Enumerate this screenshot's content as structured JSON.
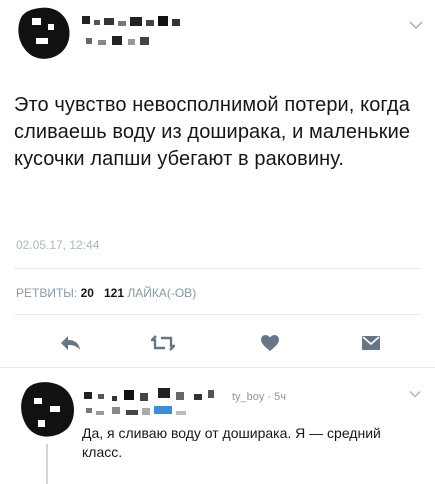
{
  "tweet": {
    "text": "Это чувство невосполнимой потери, когда сливаешь воду из доширака, и маленькие кусочки лапши убегают в раковину.",
    "timestamp": "02.05.17, 12:44",
    "retweets_label": "РЕТВИТЫ:",
    "retweets_count": "20",
    "likes_count": "121",
    "likes_label": "ЛАЙКА(-ОВ)"
  },
  "reply": {
    "handle_meta": "ty_boy · 5ч",
    "text": "Да, я сливаю воду от доширака. Я — средний класс."
  },
  "icons": {
    "reply": "reply-icon",
    "retweet": "retweet-icon",
    "like": "heart-icon",
    "message": "envelope-icon",
    "menu": "chevron-down-icon"
  },
  "colors": {
    "text": "#14171a",
    "muted": "#8899a6",
    "icon": "#657786",
    "divider": "#e6ecf0"
  }
}
